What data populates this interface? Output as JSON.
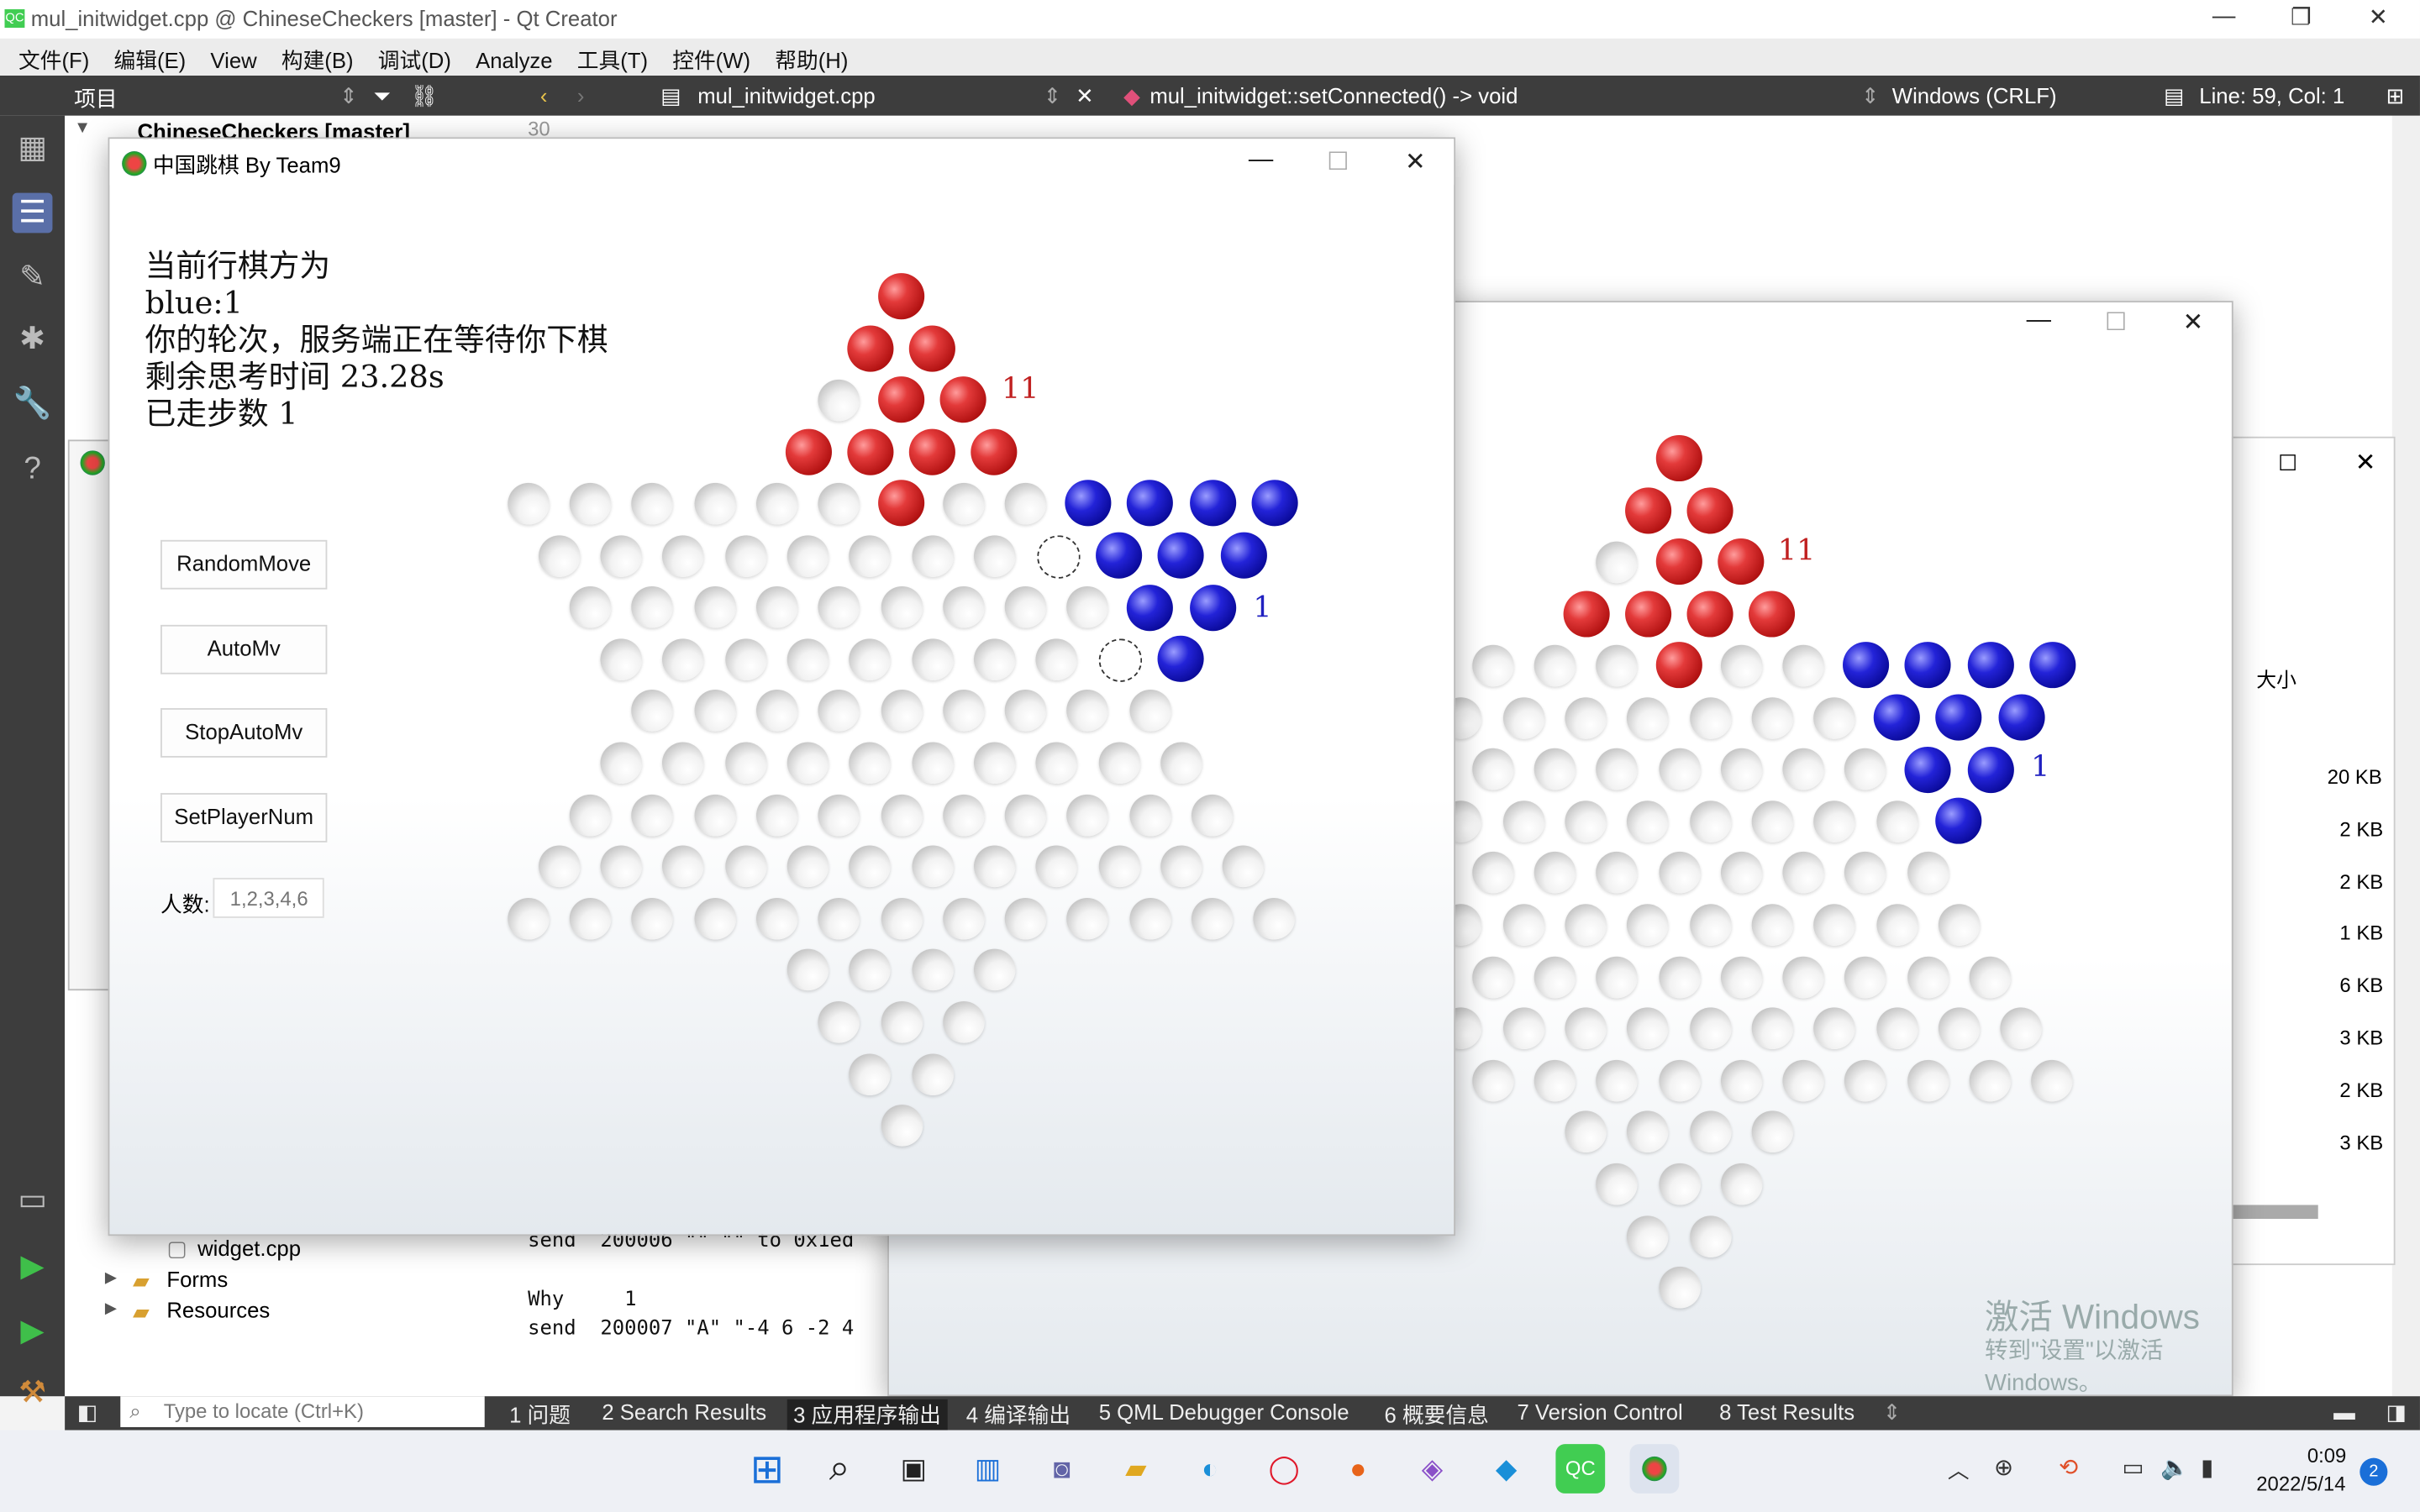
{
  "qt": {
    "title": "mul_initwidget.cpp @ ChineseCheckers [master] - Qt Creator",
    "menus": [
      "文件(F)",
      "编辑(E)",
      "View",
      "构建(B)",
      "调试(D)",
      "Analyze",
      "工具(T)",
      "控件(W)",
      "帮助(H)"
    ],
    "project_label": "项目",
    "file_tab": "mul_initwidget.cpp",
    "function_crumb": "mul_initwidget::setConnected() -> void",
    "line_ending": "Windows (CRLF)",
    "cursor_pos": "Line: 59, Col: 1",
    "tree_root": "ChineseCheckers [master]",
    "tree_items": [
      "widget.cpp",
      "Forms",
      "Resources"
    ],
    "line_number": "30",
    "output_text": "send  200006 \"\" \"\" to 0x1ed\n\nWhy     1\nsend  200007 \"A\" \"-4 6 -2 4",
    "locate_placeholder": "Type to locate (Ctrl+K)",
    "bottom_tabs": [
      "1 问题",
      "2 Search Results",
      "3 应用程序输出",
      "4 编译输出",
      "5 QML Debugger Console",
      "6 概要信息",
      "7 Version Control",
      "8 Test Results"
    ],
    "bg_window": {
      "column": "大小",
      "sizes": [
        "20 KB",
        "2 KB",
        "2 KB",
        "1 KB",
        "6 KB",
        "3 KB",
        "2 KB",
        "3 KB"
      ]
    },
    "watermark1": "激活 Windows",
    "watermark2": "转到\"设置\"以激活 Windows。"
  },
  "game": {
    "window_title": "中国跳棋 By Team9",
    "info_lines": [
      "当前行棋方为",
      "blue:1",
      "你的轮次，服务端正在等待你下棋",
      "剩余思考时间 23.28s",
      "已走步数 1"
    ],
    "buttons": [
      "RandomMove",
      "AutoMv",
      "StopAutoMv",
      "SetPlayerNum"
    ],
    "player_count_label": "人数:",
    "player_count_placeholder": "1,2,3,4,6",
    "red_player_id": "11",
    "blue_player_id": "1"
  },
  "taskbar": {
    "time": "0:09",
    "date": "2022/5/14",
    "notif": "2"
  }
}
